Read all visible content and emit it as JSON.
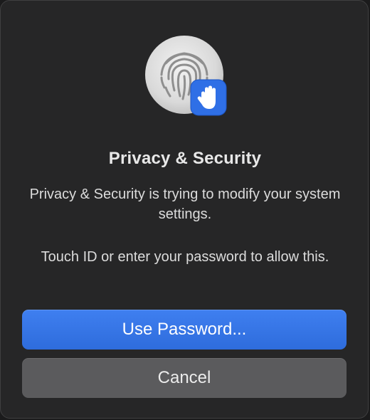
{
  "dialog": {
    "title": "Privacy & Security",
    "message_primary": "Privacy & Security is trying to modify your system settings.",
    "message_secondary": "Touch ID or enter your password to allow this.",
    "icons": {
      "main": "fingerprint-icon",
      "badge": "raised-hand-icon"
    }
  },
  "buttons": {
    "use_password": "Use Password...",
    "cancel": "Cancel"
  },
  "colors": {
    "accent": "#3478f6",
    "background": "#262627",
    "secondary_button": "#5b5b5d"
  }
}
